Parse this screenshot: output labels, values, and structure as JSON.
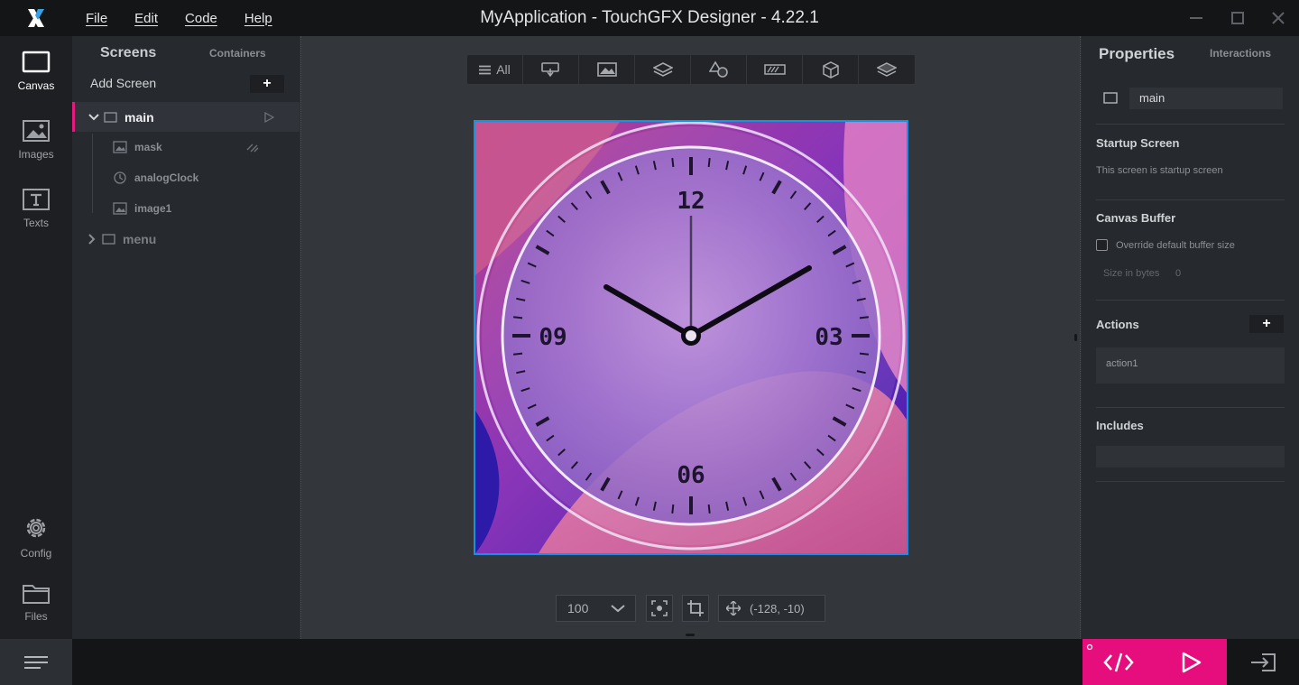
{
  "window": {
    "title": "MyApplication - TouchGFX Designer - 4.22.1",
    "menu": [
      "File",
      "Edit",
      "Code",
      "Help"
    ]
  },
  "rail": {
    "items": [
      {
        "label": "Canvas",
        "icon": "canvas-icon"
      },
      {
        "label": "Images",
        "icon": "images-icon"
      },
      {
        "label": "Texts",
        "icon": "texts-icon"
      },
      {
        "label": "Config",
        "icon": "gear-icon"
      },
      {
        "label": "Files",
        "icon": "folder-icon"
      }
    ]
  },
  "screens_panel": {
    "tab_screens": "Screens",
    "tab_containers": "Containers",
    "add_screen": "Add Screen",
    "add_symbol": "+",
    "tree": [
      {
        "label": "main",
        "expanded": true,
        "selected": true,
        "children": [
          {
            "label": "mask",
            "icon": "image-icon"
          },
          {
            "label": "analogClock",
            "icon": "clock-icon"
          },
          {
            "label": "image1",
            "icon": "image-icon"
          }
        ]
      },
      {
        "label": "menu",
        "expanded": false,
        "selected": false
      }
    ]
  },
  "canvas": {
    "filter_all": "All",
    "filter_icons": [
      "interaction-icon",
      "image-icon",
      "layers-icon",
      "shapes-icon",
      "progress-icon",
      "cube-icon",
      "stack-icon"
    ],
    "clock_numbers": [
      "12",
      "03",
      "06",
      "09"
    ],
    "zoom": "100",
    "coordinates": "(-128, -10)",
    "accent_color": "#1b8fe0"
  },
  "properties": {
    "tab_properties": "Properties",
    "tab_interactions": "Interactions",
    "name_value": "main",
    "startup_title": "Startup Screen",
    "startup_text": "This screen is startup screen",
    "buffer_title": "Canvas Buffer",
    "buffer_checkbox": "Override default buffer size",
    "size_label": "Size in bytes",
    "size_value": "0",
    "actions_title": "Actions",
    "actions_add": "+",
    "action_item": "action1",
    "includes_title": "Includes"
  },
  "bottombar": {
    "brand_color": "#e60e7c",
    "code_icon": "code-icon",
    "run_icon": "play-icon",
    "exit_icon": "exit-icon"
  }
}
